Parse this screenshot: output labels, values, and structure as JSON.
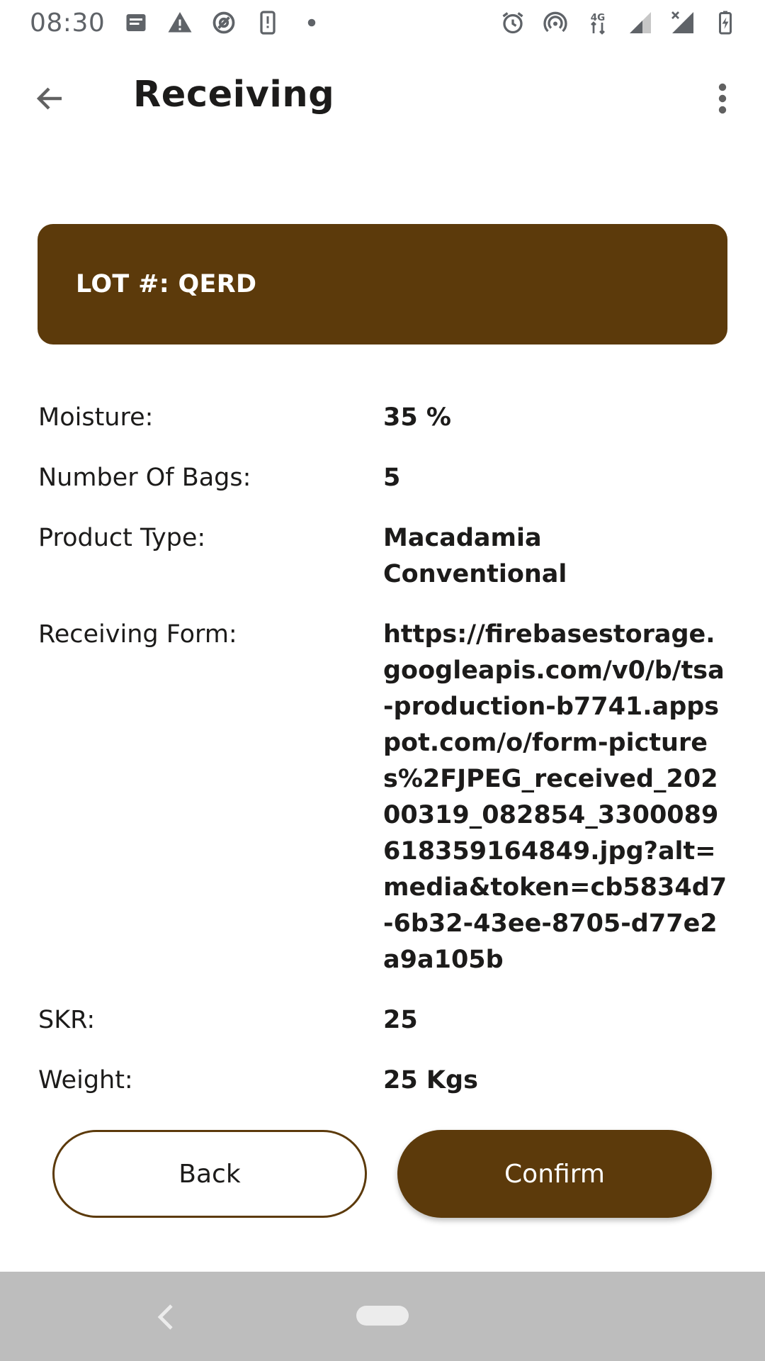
{
  "status_bar": {
    "time": "08:30",
    "network_label": "4G"
  },
  "app_bar": {
    "title": "Receiving"
  },
  "lot": {
    "label": "LOT #: QERD"
  },
  "details": [
    {
      "label": "Moisture:",
      "value": "35 %"
    },
    {
      "label": "Number Of Bags:",
      "value": "5"
    },
    {
      "label": "Product Type:",
      "value": "Macadamia Conventional"
    },
    {
      "label": "Receiving Form:",
      "value": "https://firebasestorage.googleapis.com/v0/b/tsa-production-b7741.appspot.com/o/form-pictures%2FJPEG_received_20200319_082854_3300089618359164849.jpg?alt=media&token=cb5834d7-6b32-43ee-8705-d77e2a9a105b"
    },
    {
      "label": "SKR:",
      "value": "25"
    },
    {
      "label": "Weight:",
      "value": "25 Kgs"
    }
  ],
  "buttons": {
    "back": "Back",
    "confirm": "Confirm"
  },
  "colors": {
    "brand": "#5c3a0b",
    "nav_bar": "#bdbdbd"
  }
}
